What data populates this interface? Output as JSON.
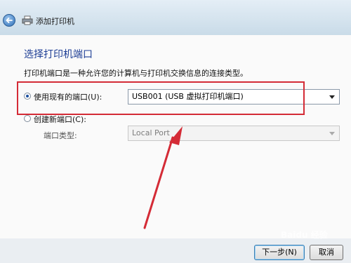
{
  "window": {
    "title": "添加打印机"
  },
  "main": {
    "heading": "选择打印机端口",
    "description": "打印机端口是一种允许您的计算机与打印机交换信息的连接类型。",
    "existing_port": {
      "label": "使用现有的端口(U):",
      "selected": "USB001 (USB 虚拟打印机端口)"
    },
    "new_port": {
      "label": "创建新端口(C):",
      "type_label": "端口类型:",
      "type_value": "Local Port"
    }
  },
  "footer": {
    "next_label": "下一步(N)",
    "cancel_label": "取消"
  },
  "watermark": "Baidu 经验",
  "colors": {
    "heading": "#1e3e95",
    "annotation": "#d42b36"
  }
}
